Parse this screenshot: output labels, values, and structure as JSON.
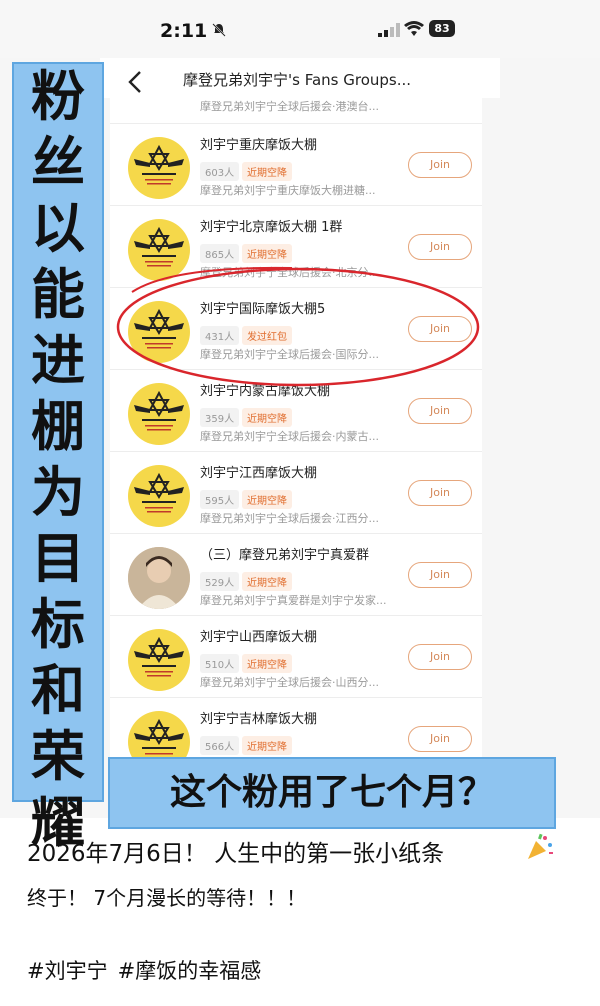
{
  "status_bar": {
    "time": "2:11",
    "battery": "83"
  },
  "nav": {
    "title": "摩登兄弟刘宇宁's Fans Groups..."
  },
  "partial_row": {
    "desc": "摩登兄弟刘宇宁全球后援会·港澳台..."
  },
  "groups": [
    {
      "name": "刘宇宁重庆摩饭大棚",
      "members": "603人",
      "status": "近期空降",
      "desc": "摩登兄弟刘宇宁重庆摩饭大棚进糖...",
      "join": "Join"
    },
    {
      "name": "刘宇宁北京摩饭大棚 1群",
      "members": "865人",
      "status": "近期空降",
      "desc": "摩登兄弟刘宇宁全球后援会·北京分...",
      "join": "Join"
    },
    {
      "name": "刘宇宁国际摩饭大棚5",
      "members": "431人",
      "status": "发过红包",
      "desc": "摩登兄弟刘宇宁全球后援会·国际分...",
      "join": "Join"
    },
    {
      "name": "刘宇宁内蒙古摩饭大棚",
      "members": "359人",
      "status": "近期空降",
      "desc": "摩登兄弟刘宇宁全球后援会·内蒙古...",
      "join": "Join"
    },
    {
      "name": "刘宇宁江西摩饭大棚",
      "members": "595人",
      "status": "近期空降",
      "desc": "摩登兄弟刘宇宁全球后援会·江西分...",
      "join": "Join"
    },
    {
      "name": "（三）摩登兄弟刘宇宁真爱群",
      "members": "529人",
      "status": "近期空降",
      "desc": "摩登兄弟刘宇宁真爱群是刘宇宁发家...",
      "join": "Join"
    },
    {
      "name": "刘宇宁山西摩饭大棚",
      "members": "510人",
      "status": "近期空降",
      "desc": "摩登兄弟刘宇宁全球后援会·山西分...",
      "join": "Join"
    },
    {
      "name": "刘宇宁吉林摩饭大棚",
      "members": "566人",
      "status": "近期空降",
      "desc": "",
      "join": "Join"
    }
  ],
  "overlay": {
    "vertical_chars": [
      "粉",
      "丝",
      "以",
      "能",
      "进",
      "棚",
      "为",
      "目",
      "标",
      "和",
      "荣",
      "耀"
    ],
    "bottom_caption": "这个粉用了七个月？"
  },
  "post": {
    "line1": "2026年7月6日！ 人生中的第一张小纸条",
    "line2": "终于！ 7个月漫长的等待！！！",
    "hashtags": [
      "#刘宇宁",
      "#摩饭的幸福感"
    ]
  },
  "colors": {
    "banner": "#8ec4f0",
    "circle": "#d9262c",
    "join": "#d4895a",
    "avatar": "#f5d84a"
  }
}
